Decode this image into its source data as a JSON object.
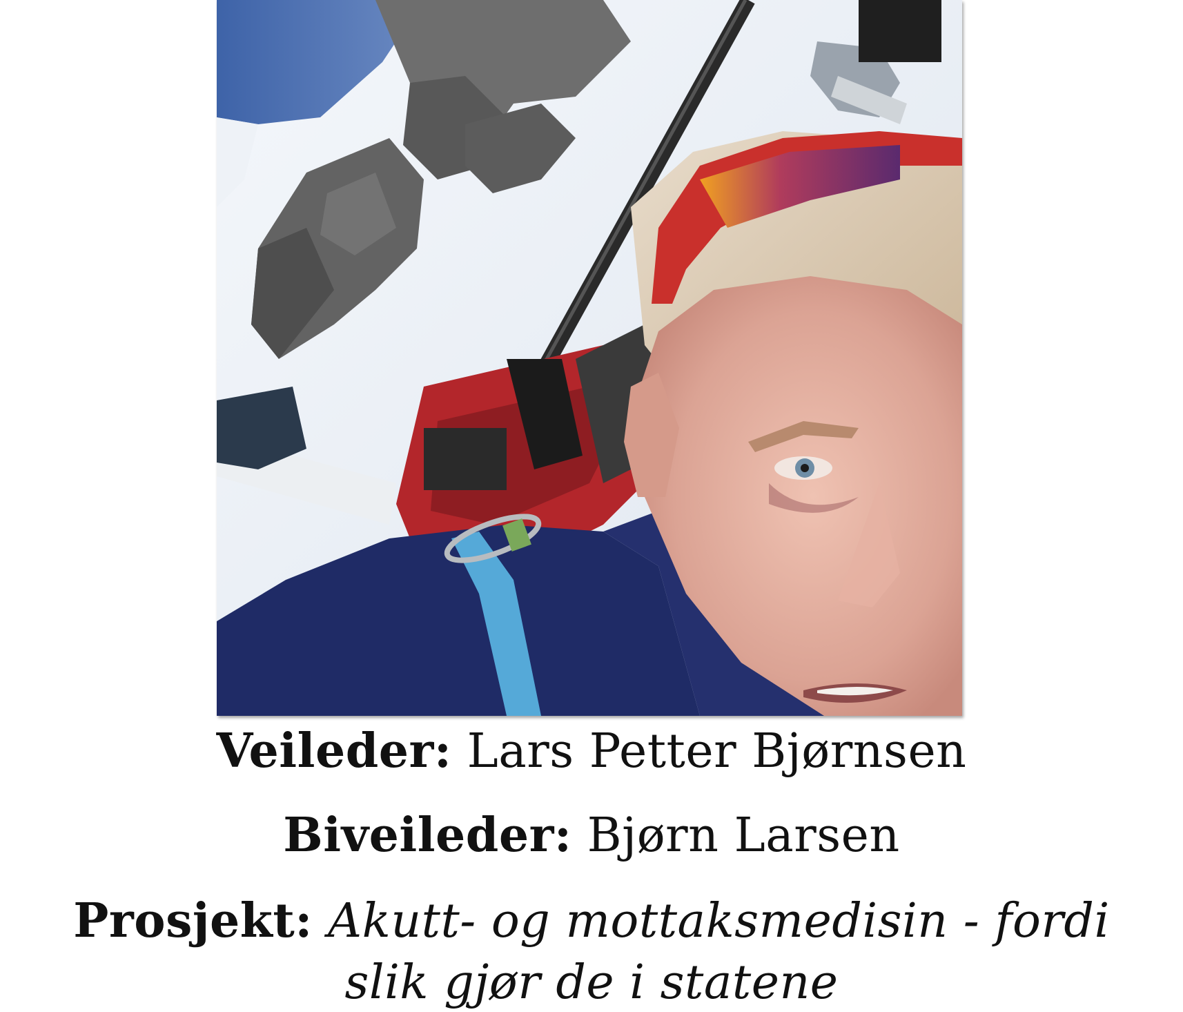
{
  "supervisor": {
    "label": "Veileder:",
    "name": "Lars Petter Bjørnsen"
  },
  "co_supervisor": {
    "label": "Biveileder:",
    "name": "Bjørn Larsen"
  },
  "project": {
    "label": "Prosjekt:",
    "title_line1": "Akutt- og mottaksmedisin - fordi",
    "title_line2": "slik gjør de i statene"
  }
}
